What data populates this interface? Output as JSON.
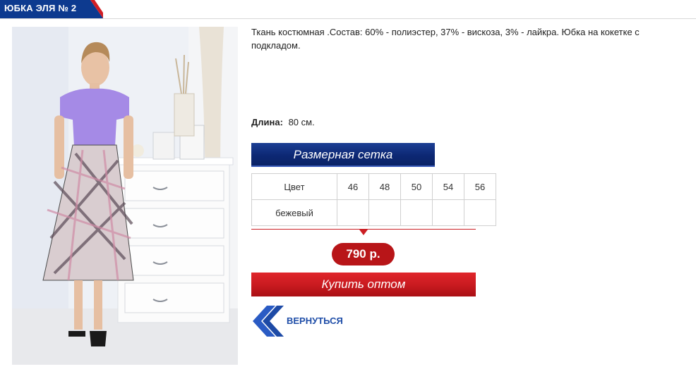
{
  "product": {
    "title": "ЮБКА ЭЛЯ № 2",
    "description": "Ткань костюмная .Состав: 60% - полиэстер, 37% - вискоза, 3% - лайкра. Юбка на кокетке с подкладом.",
    "length_label": "Длина:",
    "length_value": "80 см."
  },
  "size_chart": {
    "button_label": "Размерная сетка",
    "color_header": "Цвет",
    "sizes": [
      "46",
      "48",
      "50",
      "54",
      "56"
    ],
    "rows": [
      {
        "color": "бежевый",
        "cells": [
          "",
          "",
          "",
          "",
          ""
        ]
      }
    ]
  },
  "price": "790 р.",
  "buy_label": "Купить оптом",
  "back_label": "ВЕРНУТЬСЯ",
  "colors": {
    "brand_blue": "#0d2874",
    "brand_red": "#c81a1f",
    "link_blue": "#1f4ea8"
  },
  "icons": {
    "back": "double-chevron-left-icon"
  }
}
